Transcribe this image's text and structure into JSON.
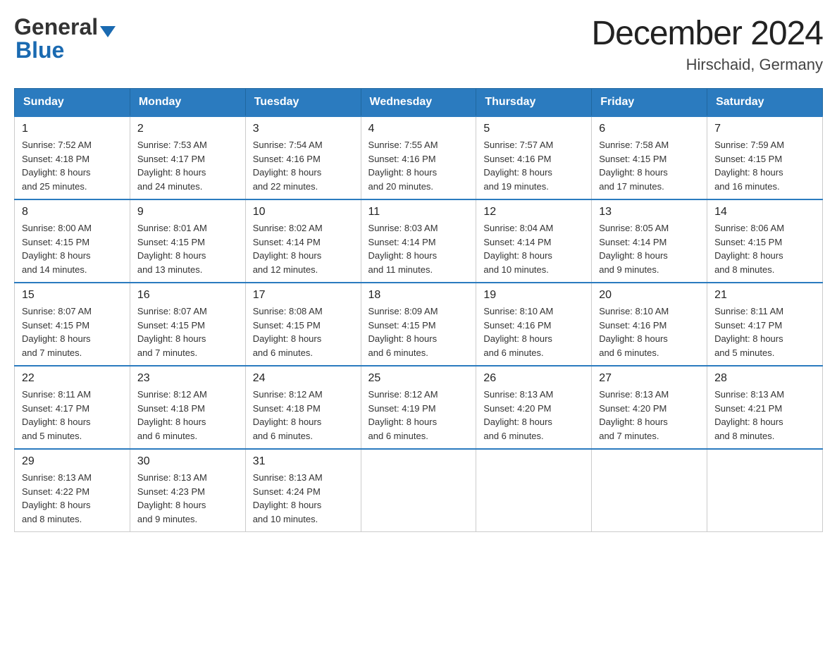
{
  "header": {
    "logo_general": "General",
    "logo_blue": "Blue",
    "month_title": "December 2024",
    "location": "Hirschaid, Germany"
  },
  "weekdays": [
    "Sunday",
    "Monday",
    "Tuesday",
    "Wednesday",
    "Thursday",
    "Friday",
    "Saturday"
  ],
  "weeks": [
    [
      {
        "day": "1",
        "sunrise": "7:52 AM",
        "sunset": "4:18 PM",
        "daylight": "8 hours and 25 minutes."
      },
      {
        "day": "2",
        "sunrise": "7:53 AM",
        "sunset": "4:17 PM",
        "daylight": "8 hours and 24 minutes."
      },
      {
        "day": "3",
        "sunrise": "7:54 AM",
        "sunset": "4:16 PM",
        "daylight": "8 hours and 22 minutes."
      },
      {
        "day": "4",
        "sunrise": "7:55 AM",
        "sunset": "4:16 PM",
        "daylight": "8 hours and 20 minutes."
      },
      {
        "day": "5",
        "sunrise": "7:57 AM",
        "sunset": "4:16 PM",
        "daylight": "8 hours and 19 minutes."
      },
      {
        "day": "6",
        "sunrise": "7:58 AM",
        "sunset": "4:15 PM",
        "daylight": "8 hours and 17 minutes."
      },
      {
        "day": "7",
        "sunrise": "7:59 AM",
        "sunset": "4:15 PM",
        "daylight": "8 hours and 16 minutes."
      }
    ],
    [
      {
        "day": "8",
        "sunrise": "8:00 AM",
        "sunset": "4:15 PM",
        "daylight": "8 hours and 14 minutes."
      },
      {
        "day": "9",
        "sunrise": "8:01 AM",
        "sunset": "4:15 PM",
        "daylight": "8 hours and 13 minutes."
      },
      {
        "day": "10",
        "sunrise": "8:02 AM",
        "sunset": "4:14 PM",
        "daylight": "8 hours and 12 minutes."
      },
      {
        "day": "11",
        "sunrise": "8:03 AM",
        "sunset": "4:14 PM",
        "daylight": "8 hours and 11 minutes."
      },
      {
        "day": "12",
        "sunrise": "8:04 AM",
        "sunset": "4:14 PM",
        "daylight": "8 hours and 10 minutes."
      },
      {
        "day": "13",
        "sunrise": "8:05 AM",
        "sunset": "4:14 PM",
        "daylight": "8 hours and 9 minutes."
      },
      {
        "day": "14",
        "sunrise": "8:06 AM",
        "sunset": "4:15 PM",
        "daylight": "8 hours and 8 minutes."
      }
    ],
    [
      {
        "day": "15",
        "sunrise": "8:07 AM",
        "sunset": "4:15 PM",
        "daylight": "8 hours and 7 minutes."
      },
      {
        "day": "16",
        "sunrise": "8:07 AM",
        "sunset": "4:15 PM",
        "daylight": "8 hours and 7 minutes."
      },
      {
        "day": "17",
        "sunrise": "8:08 AM",
        "sunset": "4:15 PM",
        "daylight": "8 hours and 6 minutes."
      },
      {
        "day": "18",
        "sunrise": "8:09 AM",
        "sunset": "4:15 PM",
        "daylight": "8 hours and 6 minutes."
      },
      {
        "day": "19",
        "sunrise": "8:10 AM",
        "sunset": "4:16 PM",
        "daylight": "8 hours and 6 minutes."
      },
      {
        "day": "20",
        "sunrise": "8:10 AM",
        "sunset": "4:16 PM",
        "daylight": "8 hours and 6 minutes."
      },
      {
        "day": "21",
        "sunrise": "8:11 AM",
        "sunset": "4:17 PM",
        "daylight": "8 hours and 5 minutes."
      }
    ],
    [
      {
        "day": "22",
        "sunrise": "8:11 AM",
        "sunset": "4:17 PM",
        "daylight": "8 hours and 5 minutes."
      },
      {
        "day": "23",
        "sunrise": "8:12 AM",
        "sunset": "4:18 PM",
        "daylight": "8 hours and 6 minutes."
      },
      {
        "day": "24",
        "sunrise": "8:12 AM",
        "sunset": "4:18 PM",
        "daylight": "8 hours and 6 minutes."
      },
      {
        "day": "25",
        "sunrise": "8:12 AM",
        "sunset": "4:19 PM",
        "daylight": "8 hours and 6 minutes."
      },
      {
        "day": "26",
        "sunrise": "8:13 AM",
        "sunset": "4:20 PM",
        "daylight": "8 hours and 6 minutes."
      },
      {
        "day": "27",
        "sunrise": "8:13 AM",
        "sunset": "4:20 PM",
        "daylight": "8 hours and 7 minutes."
      },
      {
        "day": "28",
        "sunrise": "8:13 AM",
        "sunset": "4:21 PM",
        "daylight": "8 hours and 8 minutes."
      }
    ],
    [
      {
        "day": "29",
        "sunrise": "8:13 AM",
        "sunset": "4:22 PM",
        "daylight": "8 hours and 8 minutes."
      },
      {
        "day": "30",
        "sunrise": "8:13 AM",
        "sunset": "4:23 PM",
        "daylight": "8 hours and 9 minutes."
      },
      {
        "day": "31",
        "sunrise": "8:13 AM",
        "sunset": "4:24 PM",
        "daylight": "8 hours and 10 minutes."
      },
      null,
      null,
      null,
      null
    ]
  ],
  "labels": {
    "sunrise_prefix": "Sunrise: ",
    "sunset_prefix": "Sunset: ",
    "daylight_prefix": "Daylight: "
  }
}
